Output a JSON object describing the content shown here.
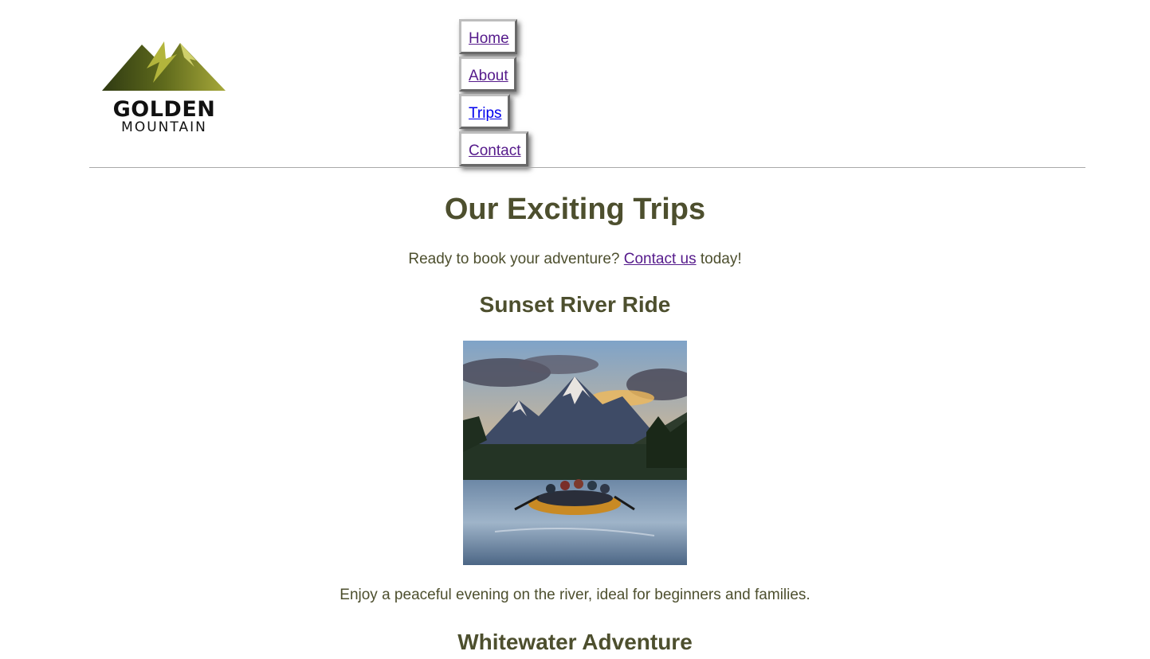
{
  "logo": {
    "line1": "GOLDEN",
    "line2": "MOUNTAIN",
    "icon": "mountain-logo-icon"
  },
  "nav": {
    "items": [
      {
        "label": "Home"
      },
      {
        "label": "About"
      },
      {
        "label": "Trips"
      },
      {
        "label": "Contact"
      }
    ]
  },
  "main": {
    "title": "Our Exciting Trips",
    "lead_prefix": "Ready to book your adventure?",
    "lead_link": "Contact us",
    "lead_suffix": "today!",
    "trips": [
      {
        "title": "Sunset River Ride",
        "image_icon": "river-rafting-sunset-photo",
        "description": "Enjoy a peaceful evening on the river, ideal for beginners and families."
      },
      {
        "title": "Whitewater Adventure"
      }
    ]
  },
  "colors": {
    "text": "#4d4f2e",
    "visited_link": "#551a8b",
    "unvisited_link": "#0000ee"
  }
}
